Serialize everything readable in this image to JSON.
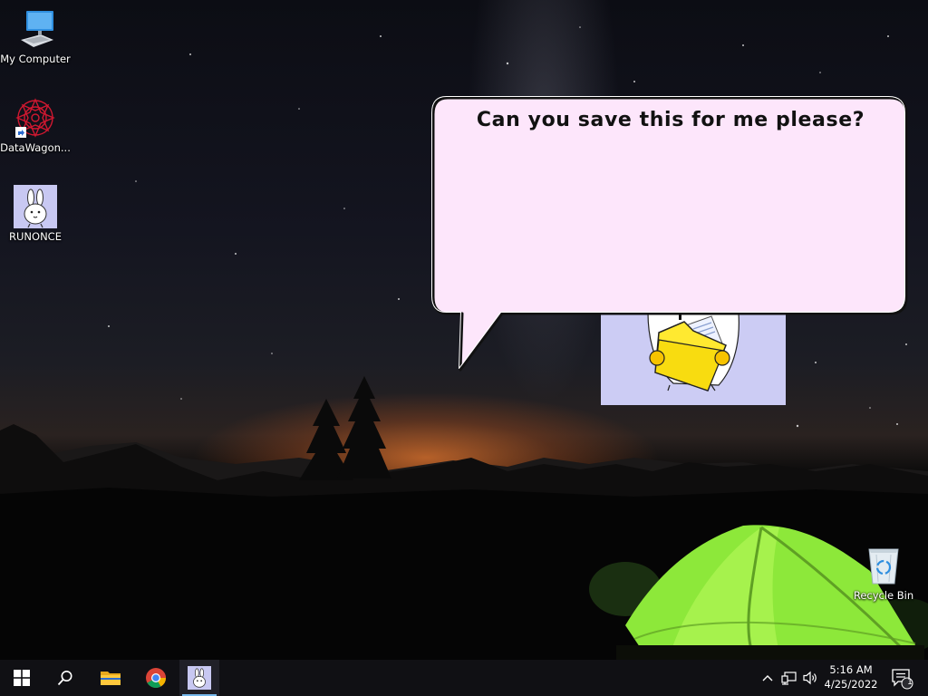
{
  "desktop": {
    "icons": [
      {
        "label": "My Computer",
        "icon": "monitor-icon"
      },
      {
        "label": "DataWagon...",
        "icon": "datawagon-mandala-icon"
      },
      {
        "label": "RUNONCE",
        "icon": "bunny-icon"
      },
      {
        "label": "Recycle Bin",
        "icon": "recycle-bin-icon"
      }
    ]
  },
  "assistant": {
    "message": "Can you save this for me please?",
    "character": "bunny-holding-folder"
  },
  "taskbar": {
    "buttons": [
      {
        "name": "start",
        "icon": "windows-logo-icon"
      },
      {
        "name": "search",
        "icon": "search-icon"
      },
      {
        "name": "file-explorer",
        "icon": "folder-icon"
      },
      {
        "name": "chrome",
        "icon": "chrome-icon"
      },
      {
        "name": "runonce",
        "icon": "bunny-icon",
        "active": true
      }
    ],
    "tray": {
      "icons": [
        "chevron-up-icon",
        "network-icon",
        "volume-icon"
      ],
      "time": "5:16 AM",
      "date": "4/25/2022",
      "notification_count": "1"
    }
  },
  "colors": {
    "bubble_fill": "#fde6fb",
    "mascot_bg": "#ccccf4",
    "taskbar_bg": "#101014",
    "active_indicator": "#76b9ed",
    "tent_green": "#8de83a"
  }
}
